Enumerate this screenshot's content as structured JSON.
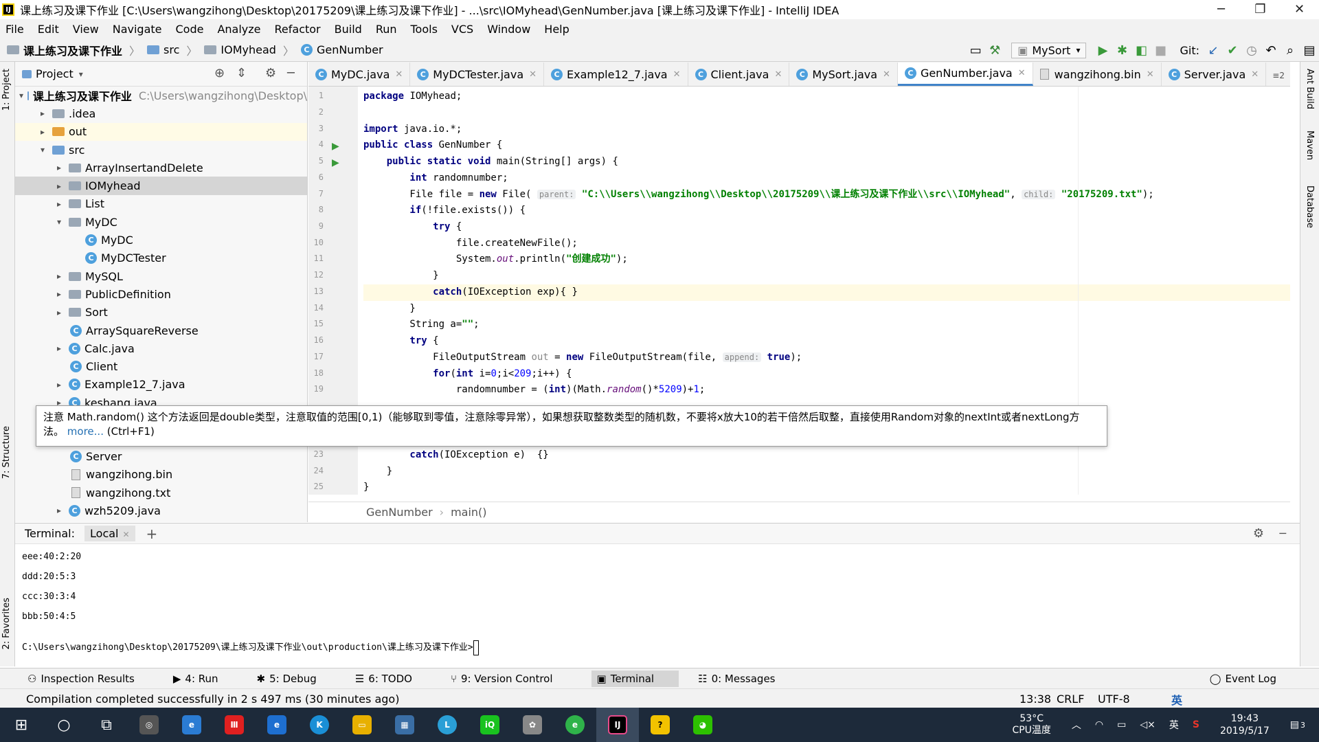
{
  "window": {
    "title": "课上练习及课下作业 [C:\\Users\\wangzihong\\Desktop\\20175209\\课上练习及课下作业] - ...\\src\\IOMyhead\\GenNumber.java [课上练习及课下作业] - IntelliJ IDEA"
  },
  "menu": [
    "File",
    "Edit",
    "View",
    "Navigate",
    "Code",
    "Analyze",
    "Refactor",
    "Build",
    "Run",
    "Tools",
    "VCS",
    "Window",
    "Help"
  ],
  "breadcrumbs": {
    "project": "课上练习及课下作业",
    "src": "src",
    "pkg": "IOMyhead",
    "file": "GenNumber"
  },
  "toolbar": {
    "run_config": "MySort",
    "git_label": "Git:"
  },
  "project_panel": {
    "title": "Project",
    "tree": [
      {
        "label": "课上练习及课下作业",
        "extra": "C:\\Users\\wangzihong\\Desktop\\",
        "icon": "folder-icon",
        "arrow": "▾"
      },
      {
        "label": ".idea",
        "icon": "folder-icon",
        "arrow": "▸"
      },
      {
        "label": "out",
        "icon": "folder-icon",
        "arrow": "▸"
      },
      {
        "label": "src",
        "icon": "folder-icon",
        "arrow": "▾"
      },
      {
        "label": "ArrayInsertandDelete",
        "icon": "folder-icon",
        "arrow": "▸"
      },
      {
        "label": "IOMyhead",
        "icon": "folder-icon",
        "arrow": "▸"
      },
      {
        "label": "List",
        "icon": "folder-icon",
        "arrow": "▸"
      },
      {
        "label": "MyDC",
        "icon": "folder-icon",
        "arrow": "▾"
      },
      {
        "label": "MyDC",
        "icon": "class-icon",
        "arrow": ""
      },
      {
        "label": "MyDCTester",
        "icon": "class-icon",
        "arrow": ""
      },
      {
        "label": "MySQL",
        "icon": "folder-icon",
        "arrow": "▸"
      },
      {
        "label": "PublicDefinition",
        "icon": "folder-icon",
        "arrow": "▸"
      },
      {
        "label": "Sort",
        "icon": "folder-icon",
        "arrow": "▸"
      },
      {
        "label": "ArraySquareReverse",
        "icon": "class-icon",
        "arrow": ""
      },
      {
        "label": "Calc.java",
        "icon": "class-icon",
        "arrow": "▸"
      },
      {
        "label": "Client",
        "icon": "class-icon",
        "arrow": ""
      },
      {
        "label": "Example12_7.java",
        "icon": "class-icon",
        "arrow": "▸"
      },
      {
        "label": "keshang.java",
        "icon": "class-icon",
        "arrow": "▸"
      },
      {
        "label": "Server",
        "icon": "class-icon",
        "arrow": ""
      },
      {
        "label": "wangzihong.bin",
        "icon": "file-icon",
        "arrow": ""
      },
      {
        "label": "wangzihong.txt",
        "icon": "file-icon",
        "arrow": ""
      },
      {
        "label": "wzh5209.java",
        "icon": "class-icon",
        "arrow": "▸"
      }
    ]
  },
  "tabs": [
    "MyDC.java",
    "MyDCTester.java",
    "Example12_7.java",
    "Client.java",
    "MySort.java",
    "GenNumber.java",
    "wangzihong.bin",
    "Server.java"
  ],
  "tabs_overflow": "≡2",
  "editor": {
    "line_numbers": [
      "1",
      "2",
      "3",
      "4",
      "5",
      "6",
      "7",
      "8",
      "9",
      "10",
      "11",
      "12",
      "13",
      "14",
      "15",
      "16",
      "17",
      "18",
      "19",
      "23",
      "24",
      "25"
    ],
    "code": {
      "l1a": "package",
      "l1b": " IOMyhead;",
      "l3a": "import",
      "l3b": " java.io.*;",
      "l4a": "public class",
      "l4b": " GenNumber {",
      "l5a": "    public static void",
      "l5b": " main(String[] args) {",
      "l6a": "        int",
      "l6b": " randomnumber;",
      "l7a": "        File file = ",
      "l7b": "new",
      "l7c": " File( ",
      "l7hint1": "parent:",
      "l7str": "\"C:\\\\Users\\\\wangzihong\\\\Desktop\\\\20175209\\\\课上练习及课下作业\\\\src\\\\IOMyhead\"",
      "l7d": ", ",
      "l7hint2": "child:",
      "l7str2": "\"20175209.txt\"",
      "l7e": ");",
      "l8a": "        if",
      "l8b": "(!file.exists()) {",
      "l9a": "            try",
      "l9b": " {",
      "l10": "                file.createNewFile();",
      "l11a": "                System.",
      "l11b": "out",
      "l11c": ".println(",
      "l11str": "\"创建成功\"",
      "l11d": ");",
      "l12": "            }",
      "l13a": "            catch",
      "l13b": "(IOException exp){ }",
      "l14": "        }",
      "l15a": "        String a=",
      "l15str": "\"\"",
      "l15b": ";",
      "l16a": "        try",
      "l16b": " {",
      "l17a": "            FileOutputStream ",
      "l17out": "out",
      "l17b": " = ",
      "l17c": "new",
      "l17d": " FileOutputStream(file, ",
      "l17hint": "append:",
      "l17e": " ",
      "l17f": "true",
      "l17g": ");",
      "l18a": "            for",
      "l18b": "(",
      "l18c": "int",
      "l18d": " i=",
      "l18n1": "0",
      "l18e": ";i<",
      "l18n2": "209",
      "l18f": ";i++) {",
      "l19a": "                randomnumber = (",
      "l19b": "int",
      "l19c": ")(Math.",
      "l19d": "random",
      "l19e": "()*",
      "l19n": "5209",
      "l19f": ")+",
      "l19n2": "1",
      "l19g": ";",
      "l23a": "        catch",
      "l23b": "(IOException e)  {}",
      "l24": "    }",
      "l25": "}"
    },
    "breadcrumb": {
      "cls": "GenNumber",
      "method": "main()"
    }
  },
  "tooltip": {
    "text": "注意 Math.random() 这个方法返回是double类型，注意取值的范围[0,1)（能够取到零值，注意除零异常），如果想获取整数类型的随机数，不要将x放大10的若干倍然后取整，直接使用Random对象的nextInt或者nextLong方法。",
    "link": "more...",
    "shortcut": "(Ctrl+F1)"
  },
  "terminal": {
    "title": "Terminal:",
    "tab": "Local",
    "lines": [
      "eee:40:2:20",
      "ddd:20:5:3",
      "ccc:30:3:4",
      "bbb:50:4:5"
    ],
    "prompt": "C:\\Users\\wangzihong\\Desktop\\20175209\\课上练习及课下作业\\out\\production\\课上练习及课下作业>"
  },
  "toolwindows": [
    "Inspection Results",
    "4: Run",
    "5: Debug",
    "6: TODO",
    "9: Version Control",
    "Terminal",
    "0: Messages"
  ],
  "event_log": "Event Log",
  "status": {
    "message": "Compilation completed successfully in 2 s 497 ms (30 minutes ago)",
    "position": "13:38",
    "line_sep": "CRLF",
    "encoding": "UTF-8",
    "ime": "英"
  },
  "side_left": [
    "1: Project",
    "7: Structure",
    "2: Favorites"
  ],
  "side_right": [
    "Ant Build",
    "Maven",
    "Database"
  ],
  "taskbar": {
    "temp": "53°C",
    "temp_label": "CPU温度",
    "time": "19:43",
    "date": "2019/5/17",
    "lang": "英",
    "notif": "3"
  }
}
